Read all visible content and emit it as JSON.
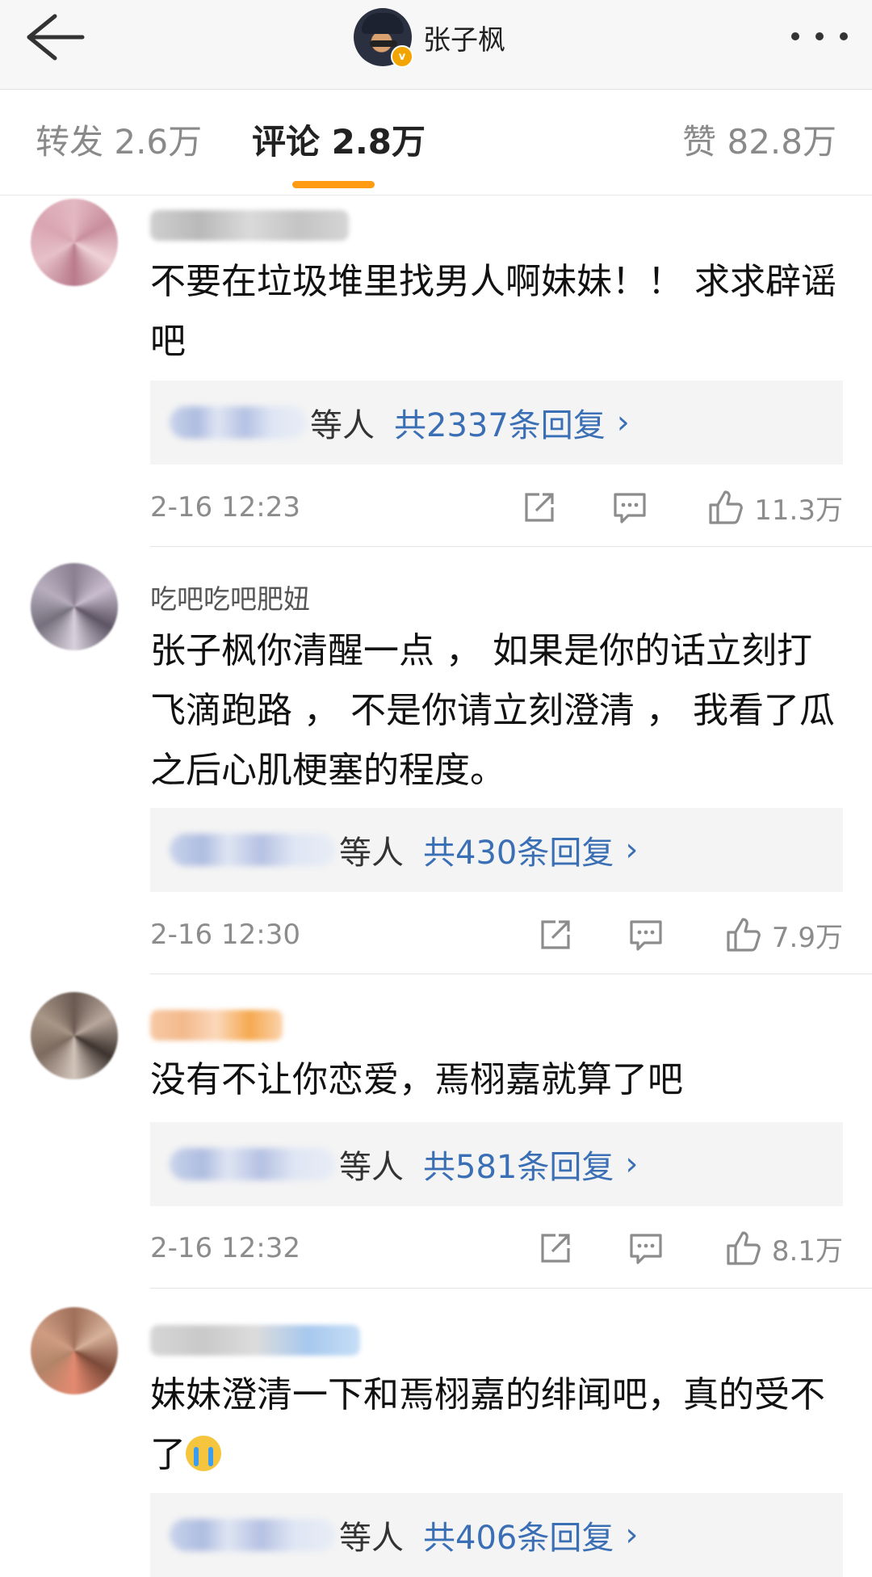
{
  "header": {
    "title": "张子枫",
    "verified_badge": "v",
    "icons": [
      "back-arrow-icon",
      "more-dots-icon"
    ]
  },
  "tabs": {
    "repost": "转发 2.6万",
    "comment": "评论 2.8万",
    "like": "赞 82.8万",
    "active": "comment"
  },
  "colors": {
    "accent": "#ff9c14",
    "link": "#3a6fb5",
    "meta": "#8c8c8c"
  },
  "comments": [
    {
      "username": "",
      "text": "不要在垃圾堆里找男人啊妹妹！！ 求求辟谣吧",
      "reply_others": "等人",
      "reply_count": "共2337条回复",
      "time": "2-16 12:23",
      "likes": "11.3万"
    },
    {
      "username": "吃吧吃吧肥妞",
      "text": "张子枫你清醒一点 ， 如果是你的话立刻打飞滴跑路 ， 不是你请立刻澄清 ， 我看了瓜之后心肌梗塞的程度。",
      "reply_others": "等人",
      "reply_count": "共430条回复",
      "time": "2-16 12:30",
      "likes": "7.9万"
    },
    {
      "username": "",
      "text": "没有不让你恋爱，焉栩嘉就算了吧",
      "reply_others": "等人",
      "reply_count": "共581条回复",
      "time": "2-16 12:32",
      "likes": "8.1万"
    },
    {
      "username": "",
      "text": "妹妹澄清一下和焉栩嘉的绯闻吧，真的受不了",
      "emoji": "crying-emoji",
      "reply_others": "等人",
      "reply_count": "共406条回复"
    }
  ]
}
